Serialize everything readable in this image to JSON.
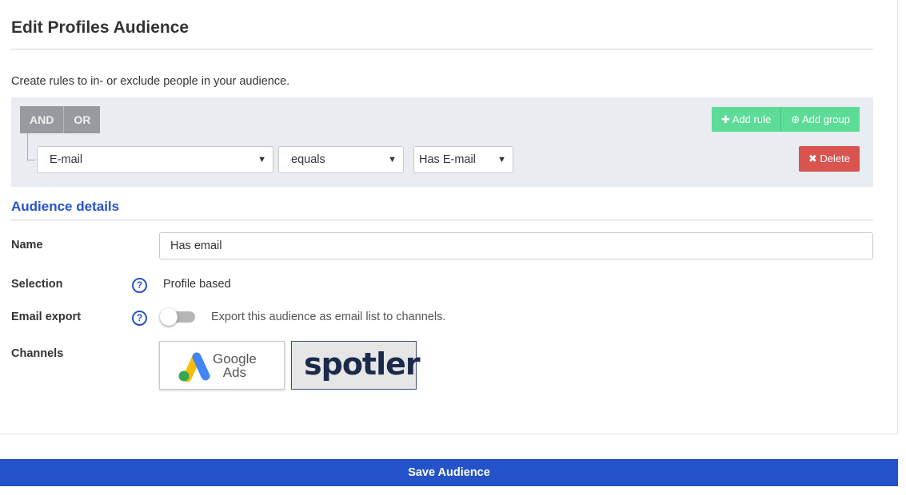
{
  "page": {
    "title": "Edit Profiles Audience",
    "intro": "Create rules to in- or exclude people in your audience."
  },
  "rules": {
    "logic": {
      "and_label": "AND",
      "or_label": "OR"
    },
    "add_rule_label": "Add rule",
    "add_group_label": "Add group",
    "delete_label": "Delete",
    "rule": {
      "field": "E-mail",
      "operator": "equals",
      "value": "Has E-mail"
    }
  },
  "details": {
    "section_title": "Audience details",
    "name_label": "Name",
    "name_value": "Has email",
    "selection_label": "Selection",
    "selection_value": "Profile based",
    "email_export_label": "Email export",
    "email_export_text": "Export this audience as email list to channels.",
    "email_export_on": false,
    "channels_label": "Channels",
    "channels": [
      {
        "name_line1": "Google",
        "name_line2": "Ads"
      },
      {
        "name": "spotler"
      }
    ]
  },
  "footer": {
    "save_label": "Save Audience"
  },
  "colors": {
    "accent": "#2453c9",
    "green": "#5ddc98",
    "danger": "#d9534f"
  }
}
